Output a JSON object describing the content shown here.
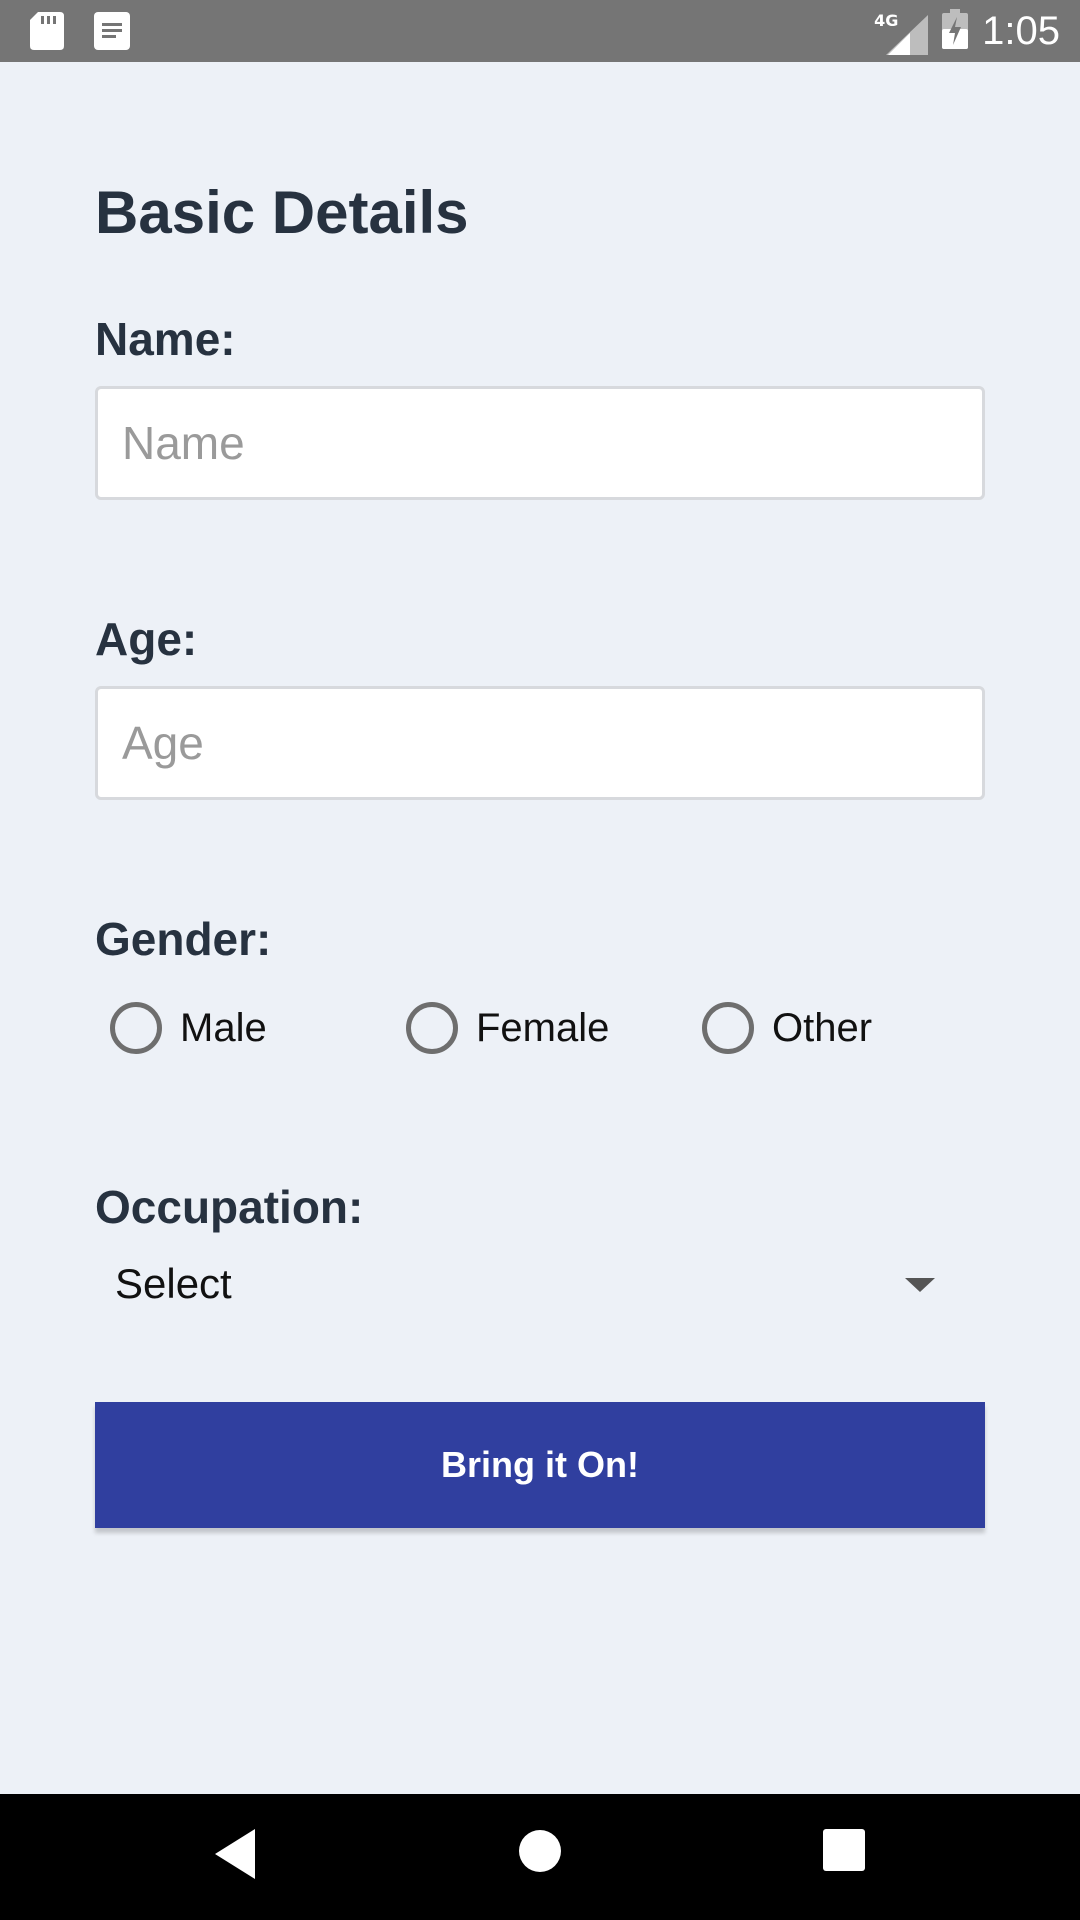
{
  "status_bar": {
    "network": "4G",
    "time": "1:05"
  },
  "form": {
    "title": "Basic Details",
    "name": {
      "label": "Name:",
      "placeholder": "Name",
      "value": ""
    },
    "age": {
      "label": "Age:",
      "placeholder": "Age",
      "value": ""
    },
    "gender": {
      "label": "Gender:",
      "options": [
        "Male",
        "Female",
        "Other"
      ],
      "selected": null
    },
    "occupation": {
      "label": "Occupation:",
      "selected": "Select"
    },
    "submit_label": "Bring it On!"
  },
  "colors": {
    "background": "#EDF1F7",
    "status_bar": "#757575",
    "accent": "#303F9F",
    "text_dark": "#273240",
    "nav_bar": "#000000"
  },
  "icons": {
    "status_left": [
      "sd-card-icon",
      "notes-icon"
    ],
    "status_right": [
      "signal-icon",
      "battery-charging-icon"
    ],
    "nav": [
      "back-icon",
      "home-icon",
      "recents-icon"
    ]
  }
}
